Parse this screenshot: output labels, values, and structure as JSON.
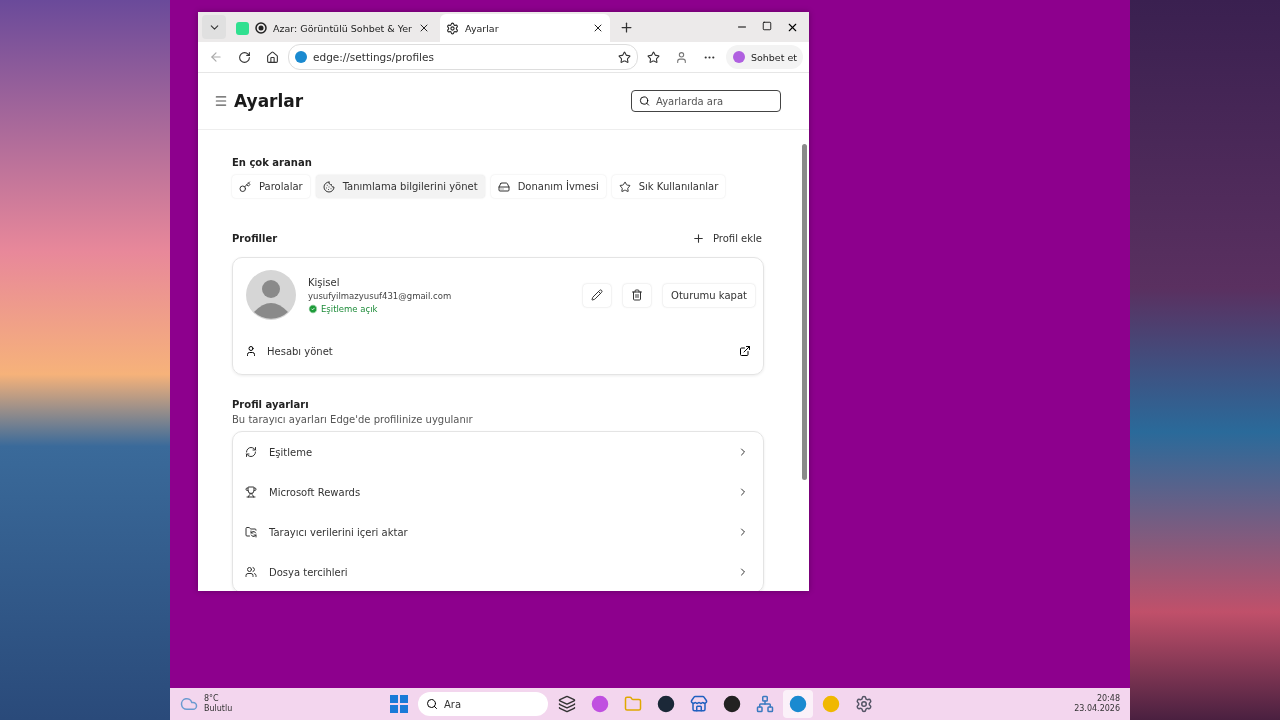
{
  "browser": {
    "tabs": [
      {
        "title": "Azar: Görüntülü Sohbet & Yer",
        "kind": "app",
        "selected": false
      },
      {
        "title": "Ayarlar",
        "kind": "settings",
        "selected": true
      }
    ],
    "address": "edge://settings/profiles",
    "copilot_label": "Sohbet et"
  },
  "settings": {
    "title": "Ayarlar",
    "search_placeholder": "Ayarlarda ara",
    "top_searched": {
      "heading": "En çok aranan",
      "chips": [
        {
          "label": "Parolalar",
          "kind": "key"
        },
        {
          "label": "Tanımlama bilgilerini yönet",
          "kind": "cookie"
        },
        {
          "label": "Donanım İvmesi",
          "kind": "drive"
        },
        {
          "label": "Sık Kullanılanlar",
          "kind": "favorites"
        }
      ]
    },
    "profiles": {
      "heading": "Profiller",
      "add_label": "Profil ekle",
      "name": "Kişisel",
      "email": "yusufyilmazyusuf431@gmail.com",
      "sync_status": "Eşitleme açık",
      "sign_out": "Oturumu kapat",
      "manage": "Hesabı yönet"
    },
    "profile_settings": {
      "heading": "Profil ayarları",
      "description": "Bu tarayıcı ayarları Edge'de profilinize uygulanır",
      "items": [
        {
          "label": "Eşitleme",
          "kind": "sync"
        },
        {
          "label": "Microsoft Rewards",
          "kind": "rewards"
        },
        {
          "label": "Tarayıcı verilerini içeri aktar",
          "kind": "import"
        },
        {
          "label": "Dosya tercihleri",
          "kind": "files"
        }
      ]
    }
  },
  "taskbar": {
    "temperature": "8°C",
    "condition": "Bulutlu",
    "search_placeholder": "Ara",
    "apps": [
      {
        "kind": "taskview",
        "active": false
      },
      {
        "kind": "copilot",
        "active": false
      },
      {
        "kind": "folder",
        "active": false
      },
      {
        "kind": "steam",
        "active": false
      },
      {
        "kind": "store",
        "active": false
      },
      {
        "kind": "recorder",
        "active": false
      },
      {
        "kind": "network",
        "active": false
      },
      {
        "kind": "edge",
        "active": true
      },
      {
        "kind": "chrome",
        "active": false
      },
      {
        "kind": "gear",
        "active": false
      }
    ],
    "time": "20:48",
    "date": "23.04.2026"
  }
}
